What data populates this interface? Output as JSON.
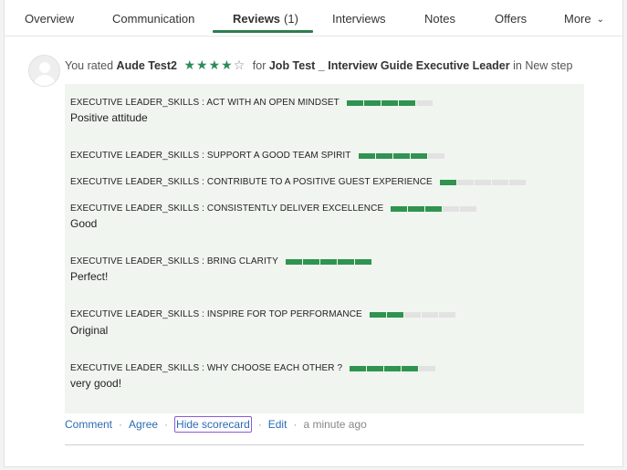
{
  "tabs": [
    {
      "label": "Overview"
    },
    {
      "label": "Communication"
    },
    {
      "label": "Reviews",
      "count": "(1)"
    },
    {
      "label": "Interviews"
    },
    {
      "label": "Notes"
    },
    {
      "label": "Offers"
    },
    {
      "label": "More"
    }
  ],
  "review": {
    "prefix": "You rated",
    "candidate": "Aude Test2",
    "rating": 4,
    "rating_max": 5,
    "for_text": "for",
    "job": "Job Test _ Interview Guide Executive Leader",
    "in_text": "in",
    "step": "New step"
  },
  "skills": [
    {
      "label": "EXECUTIVE LEADER_SKILLS : ACT WITH AN OPEN MINDSET",
      "score": 4,
      "max": 5,
      "comment": "Positive attitude"
    },
    {
      "label": "EXECUTIVE LEADER_SKILLS : SUPPORT A GOOD TEAM SPIRIT",
      "score": 4,
      "max": 5,
      "comment": ""
    },
    {
      "label": "EXECUTIVE LEADER_SKILLS : CONTRIBUTE TO A POSITIVE GUEST EXPERIENCE",
      "score": 1,
      "max": 5,
      "comment": ""
    },
    {
      "label": "EXECUTIVE LEADER_SKILLS : CONSISTENTLY DELIVER EXCELLENCE",
      "score": 3,
      "max": 5,
      "comment": "Good"
    },
    {
      "label": "EXECUTIVE LEADER_SKILLS : BRING CLARITY",
      "score": 5,
      "max": 5,
      "comment": "Perfect!"
    },
    {
      "label": "EXECUTIVE LEADER_SKILLS : INSPIRE FOR TOP PERFORMANCE",
      "score": 2,
      "max": 5,
      "comment": "Original"
    },
    {
      "label": "EXECUTIVE LEADER_SKILLS : WHY CHOOSE EACH OTHER ?",
      "score": 4,
      "max": 5,
      "comment": "very good!"
    }
  ],
  "actions": {
    "comment": "Comment",
    "agree": "Agree",
    "hide_scorecard": "Hide scorecard",
    "edit": "Edit",
    "time": "a minute ago",
    "separator": "·"
  },
  "colors": {
    "accent_green": "#2e944f",
    "link_blue": "#2c6bb3",
    "focus_outline": "#8a5bd6"
  }
}
